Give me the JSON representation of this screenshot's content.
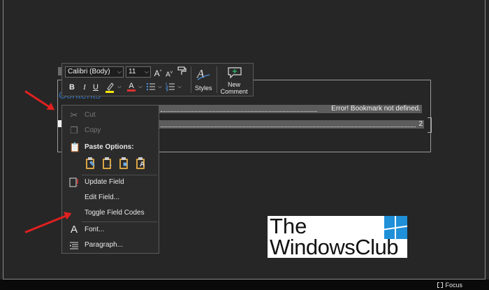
{
  "document": {
    "toc_heading": "Contents",
    "toc_line1_text": "Error! Bookmark not defined.",
    "toc_line2_text": "2"
  },
  "mini_toolbar": {
    "font_name": "Calibri (Body)",
    "font_size": "11",
    "bold": "B",
    "italic": "I",
    "underline": "U",
    "font_color_glyph": "A",
    "grow_font_glyph": "A",
    "shrink_font_glyph": "A",
    "styles_label": "Styles",
    "new_comment_label": "New Comment",
    "highlight_color": "#f5e60a",
    "font_color": "#e03030"
  },
  "context_menu": {
    "items": [
      {
        "label": "Cut",
        "icon": "scissors-icon",
        "enabled": false
      },
      {
        "label": "Copy",
        "icon": "copy-icon",
        "enabled": false
      },
      {
        "label": "Paste Options:",
        "icon": "clipboard-icon",
        "enabled": true
      },
      {
        "label": "Update Field",
        "icon": "update-field-icon",
        "enabled": true
      },
      {
        "label": "Edit Field...",
        "icon": "",
        "enabled": true
      },
      {
        "label": "Toggle Field Codes",
        "icon": "",
        "enabled": true
      },
      {
        "label": "Font...",
        "icon": "font-icon",
        "enabled": true
      },
      {
        "label": "Paragraph...",
        "icon": "paragraph-icon",
        "enabled": true
      }
    ],
    "paste_option_icons": [
      "keep-source-formatting-icon",
      "merge-formatting-icon",
      "picture-icon",
      "keep-text-only-icon"
    ]
  },
  "status_bar": {
    "focus_label": "Focus"
  },
  "watermark": {
    "line1": "The",
    "line2": "WindowsClub"
  },
  "colors": {
    "background": "#252525",
    "heading_blue": "#2f6fb7",
    "selection": "#5c5c5c",
    "arrow_red": "#e02020",
    "logo_blue": "#1f8fd8"
  }
}
